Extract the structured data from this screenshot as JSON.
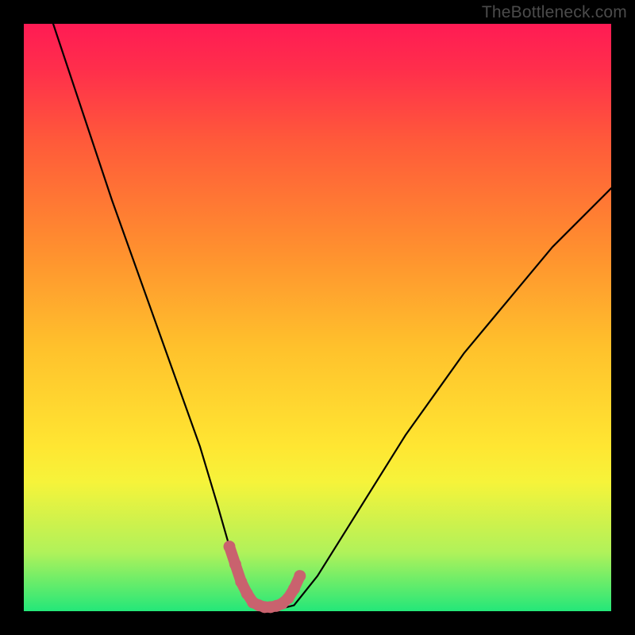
{
  "watermark": "TheBottleneck.com",
  "chart_data": {
    "type": "line",
    "title": "",
    "xlabel": "",
    "ylabel": "",
    "xlim": [
      0,
      100
    ],
    "ylim": [
      0,
      100
    ],
    "series": [
      {
        "name": "bottleneck-curve",
        "x": [
          5,
          10,
          15,
          20,
          25,
          30,
          33,
          35,
          37.5,
          40,
          42,
          44,
          46,
          50,
          55,
          60,
          65,
          70,
          75,
          80,
          85,
          90,
          95,
          100
        ],
        "y": [
          100,
          85,
          70,
          56,
          42,
          28,
          18,
          11,
          4,
          1,
          0.5,
          0.5,
          1,
          6,
          14,
          22,
          30,
          37,
          44,
          50,
          56,
          62,
          67,
          72
        ]
      }
    ],
    "highlight": {
      "name": "optimal-zone",
      "color": "#c9626e",
      "x": [
        35,
        36,
        37,
        38,
        39,
        40,
        41,
        42,
        43,
        44,
        45,
        46,
        47
      ],
      "y": [
        11,
        8,
        5,
        3,
        1.5,
        1,
        0.7,
        0.7,
        0.9,
        1.3,
        2.2,
        3.8,
        6
      ]
    }
  }
}
